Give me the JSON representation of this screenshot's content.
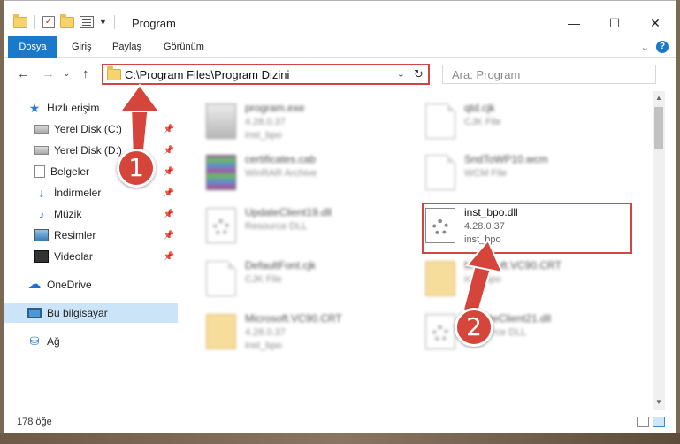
{
  "window": {
    "title": "Program",
    "minimize": "—",
    "maximize": "☐",
    "close": "✕"
  },
  "ribbon": {
    "tabs": [
      "Dosya",
      "Giriş",
      "Paylaş",
      "Görünüm"
    ],
    "expand": "⌄",
    "help": "?"
  },
  "nav": {
    "back": "←",
    "forward": "→",
    "dropdown": "⌄",
    "up": "↑",
    "address_path": "C:\\Program Files\\Program Dizini",
    "address_dropdown": "⌄",
    "refresh": "↻",
    "search_placeholder": "Ara: Program"
  },
  "sidebar": {
    "items": [
      {
        "label": "Hızlı erişim",
        "icon": "star-icon"
      },
      {
        "label": "Yerel Disk (C:)",
        "icon": "drive-icon",
        "pinned": true
      },
      {
        "label": "Yerel Disk (D:)",
        "icon": "drive-icon",
        "pinned": true
      },
      {
        "label": "Belgeler",
        "icon": "documents-icon",
        "pinned": true
      },
      {
        "label": "İndirmeler",
        "icon": "download-icon",
        "pinned": true
      },
      {
        "label": "Müzik",
        "icon": "music-icon",
        "pinned": true
      },
      {
        "label": "Resimler",
        "icon": "pictures-icon",
        "pinned": true
      },
      {
        "label": "Videolar",
        "icon": "video-icon",
        "pinned": true
      },
      {
        "label": "OneDrive",
        "icon": "cloud-icon"
      },
      {
        "label": "Bu bilgisayar",
        "icon": "computer-icon",
        "selected": true
      },
      {
        "label": "Ağ",
        "icon": "network-icon"
      }
    ],
    "pin_glyph": "📌"
  },
  "files": [
    {
      "name": "program.exe",
      "line2": "4.28.0.37",
      "line3": "inst_bpo",
      "icon": "exe-icon"
    },
    {
      "name": "qtd.cjk",
      "line2": "CJK File",
      "line3": "",
      "icon": "document-icon"
    },
    {
      "name": "certificates.cab",
      "line2": "WinRAR Archive",
      "line3": "",
      "icon": "archive-icon"
    },
    {
      "name": "SndToWP10.wcm",
      "line2": "WCM File",
      "line3": "",
      "icon": "document-icon"
    },
    {
      "name": "UpdateClient19.dll",
      "line2": "Resource DLL",
      "line3": "",
      "icon": "dll-icon"
    },
    {
      "name": "inst_bpo.dll",
      "line2": "4.28.0.37",
      "line3": "inst_bpo",
      "icon": "dll-icon"
    },
    {
      "name": "DefaultFont.cjk",
      "line2": "CJK File",
      "line3": "",
      "icon": "document-icon"
    },
    {
      "name": "Microsoft.VC90.CRT",
      "line2": "inst_bpo",
      "line3": "",
      "icon": "zip-icon"
    },
    {
      "name": "Microsoft.VC90.CRT",
      "line2": "4.28.0.37",
      "line3": "inst_bpo",
      "icon": "zip-icon"
    },
    {
      "name": "UpdateClient21.dll",
      "line2": "Resource DLL",
      "line3": "",
      "icon": "dll-icon"
    }
  ],
  "status": {
    "count": "178 öğe"
  },
  "annotations": {
    "badge1": "1",
    "badge2": "2",
    "color": "#d6453c"
  }
}
